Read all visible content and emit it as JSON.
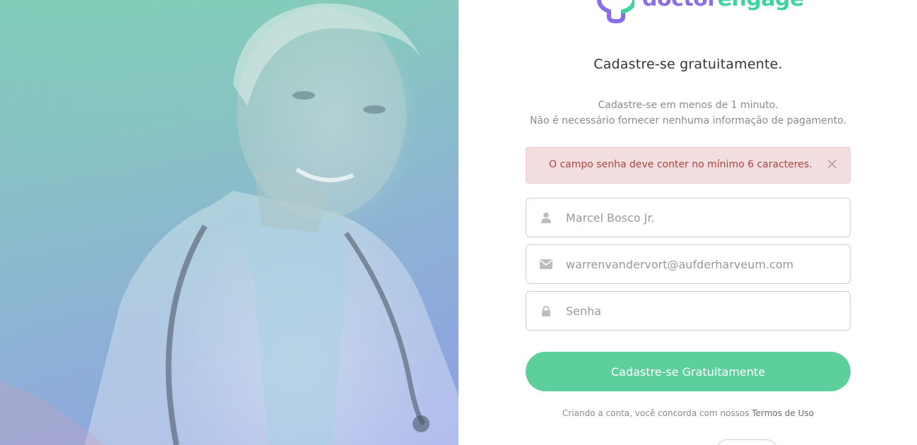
{
  "brand": {
    "logo_part1": "doctor",
    "logo_part2": "engage",
    "colors": {
      "purple": "#8a6de9",
      "green": "#3fd3a0"
    }
  },
  "signup": {
    "title": "Cadastre-se gratuitamente.",
    "subtitle_line1": "Cadastre-se em menos de 1 minuto.",
    "subtitle_line2": "Não é necessário fornecer nenhuma informação de pagamento."
  },
  "alert": {
    "message": "O campo senha deve conter no mínimo 6 caracteres.",
    "close_icon": "close-icon"
  },
  "form": {
    "name": {
      "value": "Marcel Bosco Jr.",
      "icon": "user-icon"
    },
    "email": {
      "value": "warrenvandervort@aufderharveum.com",
      "icon": "envelope-icon"
    },
    "password": {
      "placeholder": "Senha",
      "icon": "lock-icon"
    },
    "submit_label": "Cadastre-se Gratuitamente"
  },
  "footer": {
    "terms_prefix": "Criando a conta, você concorda com nossos ",
    "terms_link": "Termos de Uso"
  },
  "colors": {
    "primary_button": "#5ccf9c",
    "alert_bg": "#f2dede",
    "alert_text": "#a94442"
  }
}
